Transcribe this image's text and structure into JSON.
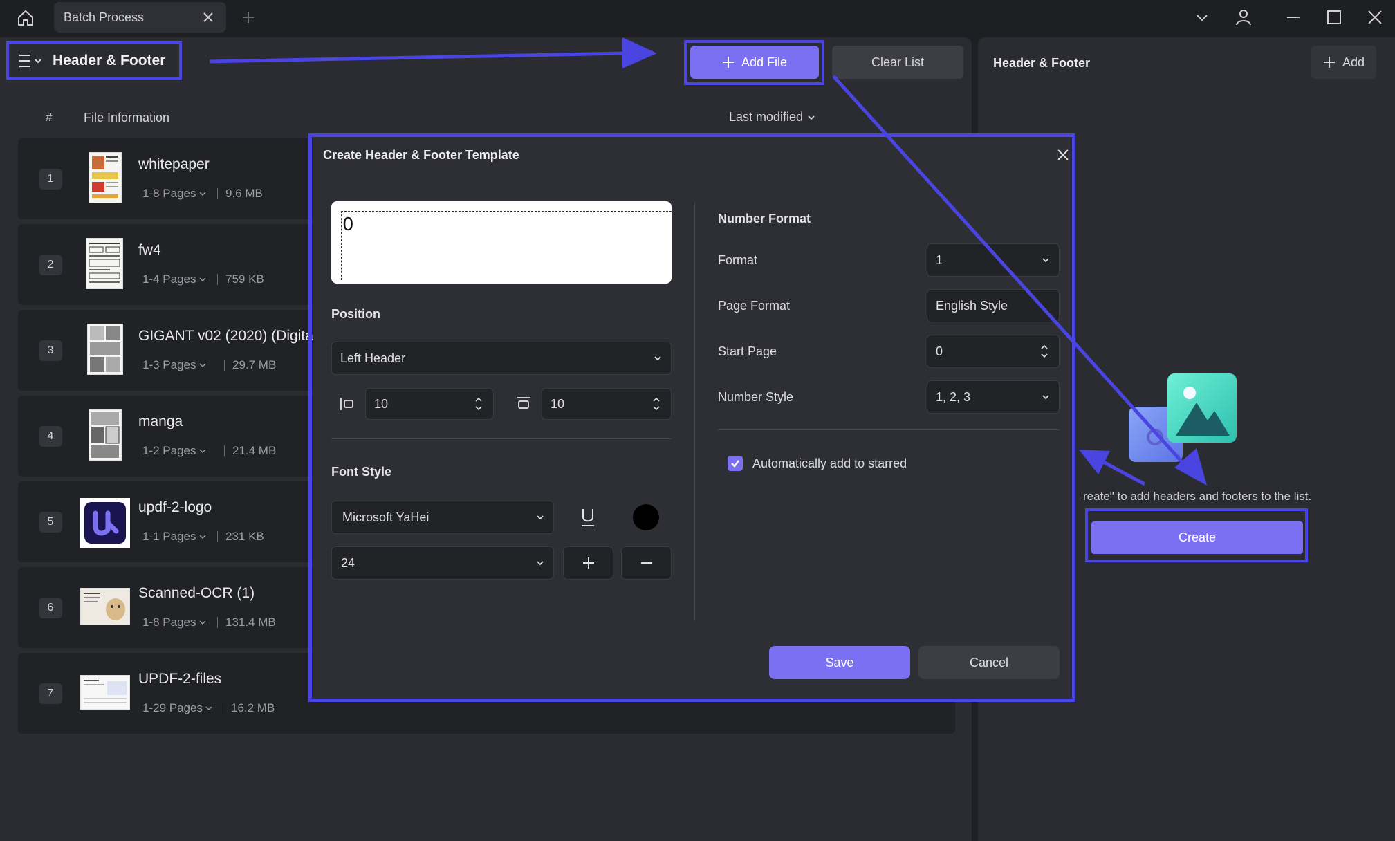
{
  "tab": {
    "label": "Batch Process"
  },
  "toolbar": {
    "menu_title": "Header & Footer",
    "add_file": "Add File",
    "clear_list": "Clear List"
  },
  "list_header": {
    "hash": "#",
    "info": "File Information",
    "sort": "Last modified"
  },
  "files": [
    {
      "num": "1",
      "name": "whitepaper",
      "pages": "1-8 Pages",
      "size": "9.6 MB"
    },
    {
      "num": "2",
      "name": "fw4",
      "pages": "1-4 Pages",
      "size": "759 KB"
    },
    {
      "num": "3",
      "name": "GIGANT v02 (2020) (Digita",
      "pages": "1-3 Pages",
      "size": "29.7 MB"
    },
    {
      "num": "4",
      "name": "manga",
      "pages": "1-2 Pages",
      "size": "21.4 MB"
    },
    {
      "num": "5",
      "name": "updf-2-logo",
      "pages": "1-1 Pages",
      "size": "231 KB"
    },
    {
      "num": "6",
      "name": "Scanned-OCR (1)",
      "pages": "1-8 Pages",
      "size": "131.4 MB"
    },
    {
      "num": "7",
      "name": "UPDF-2-files",
      "pages": "1-29 Pages",
      "size": "16.2 MB"
    }
  ],
  "right_panel": {
    "title": "Header & Footer",
    "add": "Add",
    "empty_text": "reate\" to add headers and footers to the list.",
    "create": "Create"
  },
  "modal": {
    "title": "Create Header & Footer Template",
    "preview_text": "0",
    "position_label": "Position",
    "position_value": "Left Header",
    "margin_left": "10",
    "margin_top": "10",
    "font_style_label": "Font Style",
    "font_value": "Microsoft YaHei",
    "font_size": "24",
    "font_color": "#000000",
    "number_format_label": "Number Format",
    "format_label": "Format",
    "format_value": "1",
    "page_format_label": "Page Format",
    "page_format_value": "English Style",
    "start_page_label": "Start Page",
    "start_page_value": "0",
    "number_style_label": "Number Style",
    "number_style_value": "1, 2, 3",
    "auto_star_label": "Automatically add to starred",
    "save": "Save",
    "cancel": "Cancel"
  },
  "colors": {
    "accent": "#7c70f2",
    "highlight": "#4a44e0"
  }
}
